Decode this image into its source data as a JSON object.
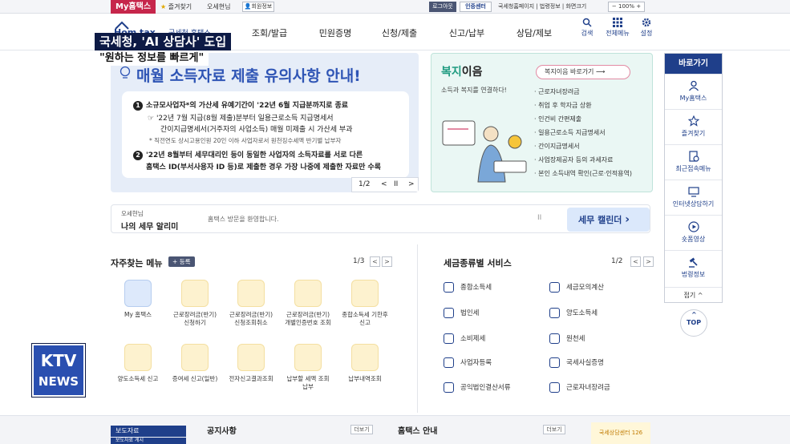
{
  "topbar": {
    "my_hometax": "My홈택스",
    "favorites": "즐겨찾기",
    "greeting": "오세현님",
    "member_info": "회원정보",
    "logout": "로그아웃",
    "cert_center": "인증센터",
    "links": "국세청홈페이지 | 법령정보 | 화면크기",
    "zoom": "100%"
  },
  "logo": {
    "small": "국세청 홈택스",
    "word": "Hom tax"
  },
  "nav": [
    "조회/발급",
    "민원증명",
    "신청/제출",
    "신고/납부",
    "상담/제보"
  ],
  "utility": [
    "검색",
    "전체메뉴",
    "설정"
  ],
  "caption": {
    "line1": "국세청, 'AI 상담사' 도입",
    "line2": "\"원하는 정보를 빠르게\""
  },
  "banner": {
    "title": "매월 소득자료 제출 유의사항 안내!",
    "item1_num": "1",
    "item1": "소규모사업자*의 가산세 유예기간이 '22년 6월 지급분까지로 종료",
    "item1_sub1": "'22년 7월 지급(8월 제출)분부터 일용근로소득 지급명세서",
    "item1_sub2": "간이지급명세서(거주자의 사업소득) 매월 미제출 시 가산세 부과",
    "item1_note": "* 직전연도 상시고용인원 20인 이하 사업자로서 원천징수세액 반기별 납부자",
    "item2_num": "2",
    "item2_line1": "'22년 8월부터 세무대리인 등이 동일한 사업자의 소득자료를 서로 다른",
    "item2_line2": "홈택스 ID(부서사용자 ID 등)로 제출한 경우 가장 나중에 제출한 자료만 수록",
    "pager": "1/2",
    "prev": "<",
    "pause": "II",
    "next": ">"
  },
  "welfare": {
    "title_a": "복지",
    "title_b": "이음",
    "subtitle": "소득과 복지를 연결하다!",
    "button": "복지이음 바로가기",
    "button_arrow": "⟶",
    "items": [
      "근로자녀장려금",
      "취업 후 학자금 상환",
      "인건비 간편제출",
      "일용근로소득 지급명세서",
      "간이지급명세서",
      "사업장제공자 등의 과세자료",
      "본인 소득내역 확인(근로·인적용역)"
    ]
  },
  "quick": {
    "header": "바로가기",
    "items": [
      "My홈택스",
      "즐겨찾기",
      "최근접속메뉴",
      "인터넷상담하기",
      "숏폼영상",
      "법령정보"
    ],
    "collapse": "접기 ^",
    "top": "TOP"
  },
  "notice": {
    "greeting": "오세현님",
    "label": "나의 세무 알리미",
    "message": "홈택스 방문을 환영합니다.",
    "pause": "II",
    "calendar": "세무 캘린더",
    "calendar_arrow": "›"
  },
  "favorites": {
    "title": "자주찾는 메뉴",
    "register": "등록",
    "pager": "1/3",
    "prev": "<",
    "next": ">",
    "items": [
      "My 홈택스",
      "근로장려금(반기) 신청하기",
      "근로장려금(반기) 신청조회취소",
      "근로장려금(반기) 개별인증번호 조회",
      "종합소득세 기한후신고",
      "양도소득세 신고",
      "증여세 신고(일반)",
      "전자신고결과조회",
      "납부할 세액 조회납부",
      "납부내역조회"
    ]
  },
  "services": {
    "title": "세금종류별 서비스",
    "pager": "1/2",
    "prev": "<",
    "next": ">",
    "left": [
      "종합소득세",
      "법인세",
      "소비제세",
      "사업자등록",
      "공익법인결산서류"
    ],
    "right": [
      "세금모의계산",
      "양도소득세",
      "원천세",
      "국세사실증명",
      "근로자녀장려금"
    ]
  },
  "bottom": {
    "press": "보도자료",
    "press2": "보도자료 게시",
    "notice": "공지사항",
    "notice_more": "더보기",
    "hometax_info": "홈택스 안내",
    "info_more": "더보기",
    "promo": "국세상담센터 126"
  },
  "ktv": {
    "line1": "KTV",
    "line2": "NEWS"
  },
  "colors": {
    "navy": "#1f3f8a",
    "red_tab": "#c6264b",
    "banner_blue": "#2f55b5",
    "welfare_green": "#1f9b80",
    "caption_bg": "#0d1a45"
  }
}
